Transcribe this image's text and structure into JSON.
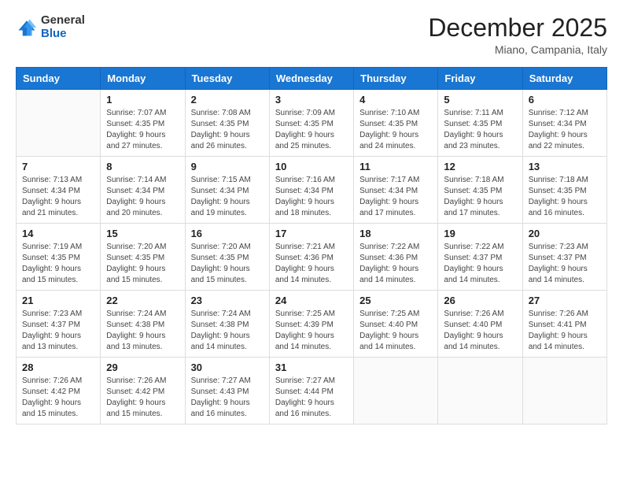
{
  "header": {
    "logo_general": "General",
    "logo_blue": "Blue",
    "month_title": "December 2025",
    "location": "Miano, Campania, Italy"
  },
  "days_of_week": [
    "Sunday",
    "Monday",
    "Tuesday",
    "Wednesday",
    "Thursday",
    "Friday",
    "Saturday"
  ],
  "weeks": [
    [
      {
        "day": "",
        "info": ""
      },
      {
        "day": "1",
        "info": "Sunrise: 7:07 AM\nSunset: 4:35 PM\nDaylight: 9 hours\nand 27 minutes."
      },
      {
        "day": "2",
        "info": "Sunrise: 7:08 AM\nSunset: 4:35 PM\nDaylight: 9 hours\nand 26 minutes."
      },
      {
        "day": "3",
        "info": "Sunrise: 7:09 AM\nSunset: 4:35 PM\nDaylight: 9 hours\nand 25 minutes."
      },
      {
        "day": "4",
        "info": "Sunrise: 7:10 AM\nSunset: 4:35 PM\nDaylight: 9 hours\nand 24 minutes."
      },
      {
        "day": "5",
        "info": "Sunrise: 7:11 AM\nSunset: 4:35 PM\nDaylight: 9 hours\nand 23 minutes."
      },
      {
        "day": "6",
        "info": "Sunrise: 7:12 AM\nSunset: 4:34 PM\nDaylight: 9 hours\nand 22 minutes."
      }
    ],
    [
      {
        "day": "7",
        "info": "Sunrise: 7:13 AM\nSunset: 4:34 PM\nDaylight: 9 hours\nand 21 minutes."
      },
      {
        "day": "8",
        "info": "Sunrise: 7:14 AM\nSunset: 4:34 PM\nDaylight: 9 hours\nand 20 minutes."
      },
      {
        "day": "9",
        "info": "Sunrise: 7:15 AM\nSunset: 4:34 PM\nDaylight: 9 hours\nand 19 minutes."
      },
      {
        "day": "10",
        "info": "Sunrise: 7:16 AM\nSunset: 4:34 PM\nDaylight: 9 hours\nand 18 minutes."
      },
      {
        "day": "11",
        "info": "Sunrise: 7:17 AM\nSunset: 4:34 PM\nDaylight: 9 hours\nand 17 minutes."
      },
      {
        "day": "12",
        "info": "Sunrise: 7:18 AM\nSunset: 4:35 PM\nDaylight: 9 hours\nand 17 minutes."
      },
      {
        "day": "13",
        "info": "Sunrise: 7:18 AM\nSunset: 4:35 PM\nDaylight: 9 hours\nand 16 minutes."
      }
    ],
    [
      {
        "day": "14",
        "info": "Sunrise: 7:19 AM\nSunset: 4:35 PM\nDaylight: 9 hours\nand 15 minutes."
      },
      {
        "day": "15",
        "info": "Sunrise: 7:20 AM\nSunset: 4:35 PM\nDaylight: 9 hours\nand 15 minutes."
      },
      {
        "day": "16",
        "info": "Sunrise: 7:20 AM\nSunset: 4:35 PM\nDaylight: 9 hours\nand 15 minutes."
      },
      {
        "day": "17",
        "info": "Sunrise: 7:21 AM\nSunset: 4:36 PM\nDaylight: 9 hours\nand 14 minutes."
      },
      {
        "day": "18",
        "info": "Sunrise: 7:22 AM\nSunset: 4:36 PM\nDaylight: 9 hours\nand 14 minutes."
      },
      {
        "day": "19",
        "info": "Sunrise: 7:22 AM\nSunset: 4:37 PM\nDaylight: 9 hours\nand 14 minutes."
      },
      {
        "day": "20",
        "info": "Sunrise: 7:23 AM\nSunset: 4:37 PM\nDaylight: 9 hours\nand 14 minutes."
      }
    ],
    [
      {
        "day": "21",
        "info": "Sunrise: 7:23 AM\nSunset: 4:37 PM\nDaylight: 9 hours\nand 13 minutes."
      },
      {
        "day": "22",
        "info": "Sunrise: 7:24 AM\nSunset: 4:38 PM\nDaylight: 9 hours\nand 13 minutes."
      },
      {
        "day": "23",
        "info": "Sunrise: 7:24 AM\nSunset: 4:38 PM\nDaylight: 9 hours\nand 14 minutes."
      },
      {
        "day": "24",
        "info": "Sunrise: 7:25 AM\nSunset: 4:39 PM\nDaylight: 9 hours\nand 14 minutes."
      },
      {
        "day": "25",
        "info": "Sunrise: 7:25 AM\nSunset: 4:40 PM\nDaylight: 9 hours\nand 14 minutes."
      },
      {
        "day": "26",
        "info": "Sunrise: 7:26 AM\nSunset: 4:40 PM\nDaylight: 9 hours\nand 14 minutes."
      },
      {
        "day": "27",
        "info": "Sunrise: 7:26 AM\nSunset: 4:41 PM\nDaylight: 9 hours\nand 14 minutes."
      }
    ],
    [
      {
        "day": "28",
        "info": "Sunrise: 7:26 AM\nSunset: 4:42 PM\nDaylight: 9 hours\nand 15 minutes."
      },
      {
        "day": "29",
        "info": "Sunrise: 7:26 AM\nSunset: 4:42 PM\nDaylight: 9 hours\nand 15 minutes."
      },
      {
        "day": "30",
        "info": "Sunrise: 7:27 AM\nSunset: 4:43 PM\nDaylight: 9 hours\nand 16 minutes."
      },
      {
        "day": "31",
        "info": "Sunrise: 7:27 AM\nSunset: 4:44 PM\nDaylight: 9 hours\nand 16 minutes."
      },
      {
        "day": "",
        "info": ""
      },
      {
        "day": "",
        "info": ""
      },
      {
        "day": "",
        "info": ""
      }
    ]
  ]
}
